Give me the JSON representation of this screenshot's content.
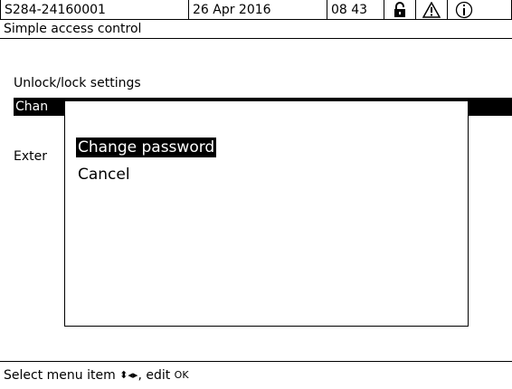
{
  "header": {
    "device_id": "S284-24160001",
    "date": "26 Apr  2016",
    "time": "08 43",
    "icons": [
      "unlocked-padlock-icon",
      "warning-icon",
      "info-icon"
    ]
  },
  "subtitle": "Simple access control",
  "settings": {
    "section_label": "Unlock/lock settings",
    "selected_item_partial": "Chan",
    "second_item_partial": "Exter"
  },
  "dialog": {
    "items": [
      {
        "label": "Change password",
        "selected": true
      },
      {
        "label": "Cancel",
        "selected": false
      }
    ]
  },
  "statusbar": {
    "text_prefix": "Select menu item ",
    "nav_glyph": "⬍◂▸",
    "text_middle": ", edit ",
    "ok_glyph": "OK"
  }
}
